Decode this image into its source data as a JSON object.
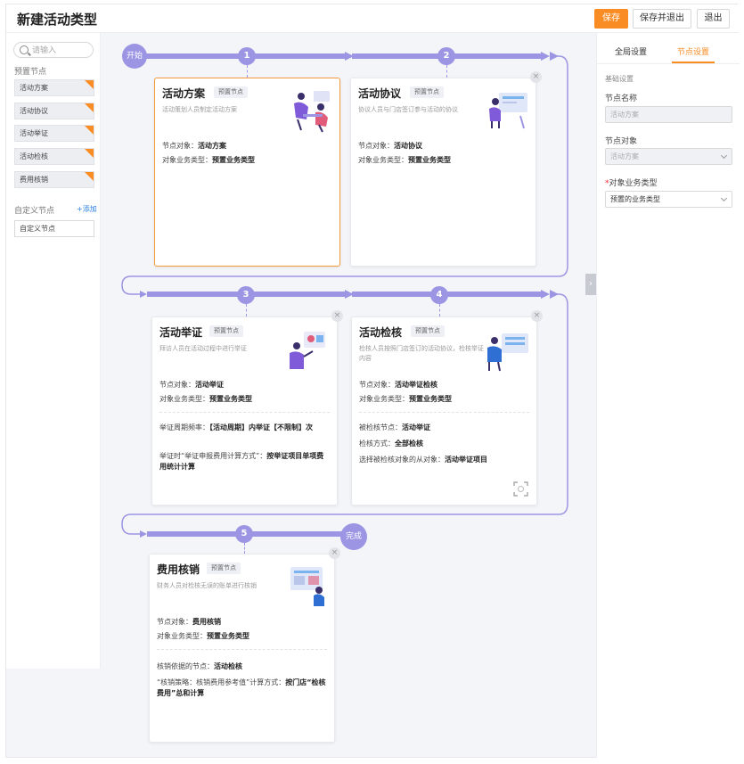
{
  "header": {
    "title": "新建活动类型",
    "save_label": "保存",
    "save_exit_label": "保存并退出",
    "exit_label": "退出"
  },
  "left_panel": {
    "search_placeholder": "请输入",
    "preset_label": "预置节点",
    "preset_items": [
      "活动方案",
      "活动协议",
      "活动举证",
      "活动检核",
      "费用核销"
    ],
    "custom_label": "自定义节点",
    "add_label": "+添加",
    "custom_item": "自定义节点"
  },
  "flow": {
    "start_label": "开始",
    "end_label": "完成",
    "accent_color": "#9b95e4",
    "selected_color": "#f59a3a",
    "steps": [
      {
        "number": "1",
        "title": "活动方案",
        "tag": "预置节点",
        "desc": "活动策划人员制定活动方案",
        "object_label": "节点对象：",
        "object_value": "活动方案",
        "biz_label": "对象业务类型：",
        "biz_value": "预置业务类型"
      },
      {
        "number": "2",
        "title": "活动协议",
        "tag": "预置节点",
        "desc": "协议人员与门店签订参与活动的协议",
        "object_label": "节点对象：",
        "object_value": "活动协议",
        "biz_label": "对象业务类型：",
        "biz_value": "预置业务类型"
      },
      {
        "number": "3",
        "title": "活动举证",
        "tag": "预置节点",
        "desc": "拜访人员在活动过程中进行举证",
        "object_label": "节点对象：",
        "object_value": "活动举证",
        "biz_label": "对象业务类型：",
        "biz_value": "预置业务类型",
        "extra1_label": "举证周期频率：",
        "extra1_value": "【活动周期】内举证【不限制】次",
        "extra2_label": "举证时“举证申报费用计算方式”：",
        "extra2_value": "按举证项目单项费用统计计算"
      },
      {
        "number": "4",
        "title": "活动检核",
        "tag": "预置节点",
        "desc": "检核人员按照门店签订的活动协议，检核举证内容",
        "object_label": "节点对象：",
        "object_value": "活动举证检核",
        "biz_label": "对象业务类型：",
        "biz_value": "预置业务类型",
        "extra1_label": "被检核节点：",
        "extra1_value": "活动举证",
        "extra2_label": "检核方式：",
        "extra2_value": "全部检核",
        "extra3_label": "选择被检核对象的从对象：",
        "extra3_value": "活动举证项目"
      },
      {
        "number": "5",
        "title": "费用核销",
        "tag": "预置节点",
        "desc": "财务人员对检核无误的账单进行核销",
        "object_label": "节点对象：",
        "object_value": "费用核销",
        "biz_label": "对象业务类型：",
        "biz_value": "预置业务类型",
        "extra1_label": "核销依据的节点：",
        "extra1_value": "活动检核",
        "extra2_label": "“核销策略：核销费用参考值”计算方式：",
        "extra2_value": "按门店“检核费用”总和计算"
      }
    ]
  },
  "right_panel": {
    "tab_global": "全局设置",
    "tab_node": "节点设置",
    "section_title": "基础设置",
    "node_name_label": "节点名称",
    "node_name_value": "活动方案",
    "node_object_label": "节点对象",
    "node_object_value": "活动方案",
    "biz_type_required": "*",
    "biz_type_label": "对象业务类型",
    "biz_type_value": "预置的业务类型"
  }
}
